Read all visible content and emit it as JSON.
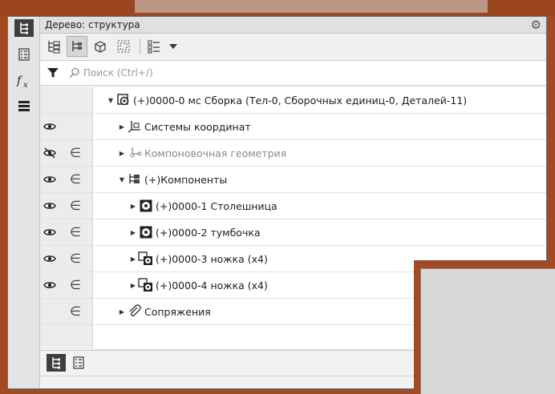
{
  "panel": {
    "title": "Дерево: структура"
  },
  "search": {
    "placeholder": "Поиск (Ctrl+/)"
  },
  "tree": {
    "rows": [
      {
        "label": "(+)0000-0 мс Сборка (Тел-0, Сборочных единиц-0, Деталей-11)",
        "icon": "assembly-icon",
        "visible": null,
        "included": false,
        "expanded": true,
        "level": 0
      },
      {
        "label": "Системы координат",
        "icon": "coordinate-systems-icon",
        "visible": true,
        "included": false,
        "expanded": false,
        "level": 1
      },
      {
        "label": "Компоновочная геометрия",
        "icon": "layout-geometry-icon",
        "visible": false,
        "included": true,
        "expanded": false,
        "level": 1,
        "dim": true
      },
      {
        "label": "(+)Компоненты",
        "icon": "components-icon",
        "visible": true,
        "included": true,
        "expanded": true,
        "level": 1
      },
      {
        "label": "(+)0000-1 Столешница",
        "icon": "part-icon",
        "visible": true,
        "included": true,
        "expanded": false,
        "level": 2
      },
      {
        "label": "(+)0000-2 тумбочка",
        "icon": "part-icon",
        "visible": true,
        "included": true,
        "expanded": false,
        "level": 2
      },
      {
        "label": "(+)0000-3 ножка (x4)",
        "icon": "multi-part-icon",
        "visible": true,
        "included": true,
        "expanded": false,
        "level": 2
      },
      {
        "label": "(+)0000-4 ножка (x4)",
        "icon": "multi-part-icon",
        "visible": true,
        "included": true,
        "expanded": false,
        "level": 2
      },
      {
        "label": "Сопряжения",
        "icon": "mates-icon",
        "visible": null,
        "included": true,
        "expanded": false,
        "level": 1
      }
    ],
    "included_symbol": "∈"
  },
  "colors": {
    "background": "#a24a23",
    "panel": "#f2f2f2",
    "active_tab": "#3e3e3e"
  }
}
